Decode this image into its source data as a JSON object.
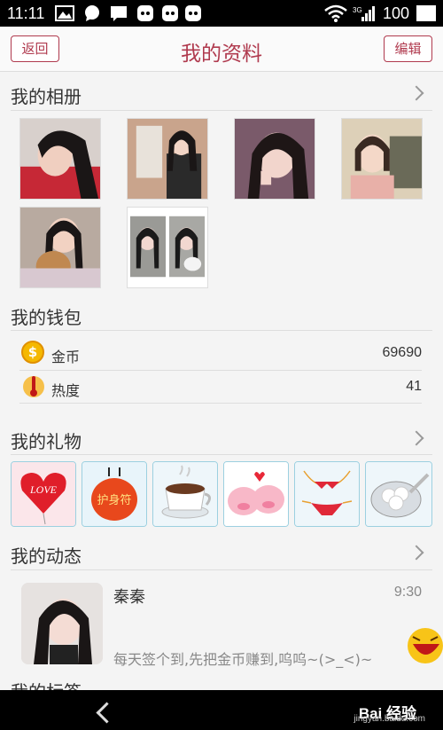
{
  "status_bar": {
    "time": "11:11",
    "battery": "100",
    "network": "3G"
  },
  "header": {
    "back_label": "返回",
    "title": "我的资料",
    "edit_label": "编辑"
  },
  "album": {
    "title": "我的相册"
  },
  "wallet": {
    "title": "我的钱包",
    "rows": [
      {
        "label": "金币",
        "value": "69690",
        "icon": "coin-icon"
      },
      {
        "label": "热度",
        "value": "41",
        "icon": "thermometer-icon"
      }
    ]
  },
  "gifts": {
    "title": "我的礼物",
    "items": [
      {
        "name": "heart-balloon",
        "text": "LOVE"
      },
      {
        "name": "amulet",
        "text": "护身符"
      },
      {
        "name": "coffee-cup",
        "text": ""
      },
      {
        "name": "pig-couple",
        "text": ""
      },
      {
        "name": "bikini",
        "text": ""
      },
      {
        "name": "rice-balls",
        "text": ""
      }
    ]
  },
  "feed": {
    "title": "我的动态",
    "post": {
      "user": "秦秦",
      "time": "9:30",
      "message": "每天签个到,先把金币赚到,呜呜~(>_<)~"
    }
  },
  "tags": {
    "title": "我的标签"
  },
  "watermark": {
    "brand": "Bai 经验",
    "site": "jingyan.baidu.com"
  },
  "colors": {
    "accent": "#b03a4e",
    "background": "#f4f4f4"
  }
}
